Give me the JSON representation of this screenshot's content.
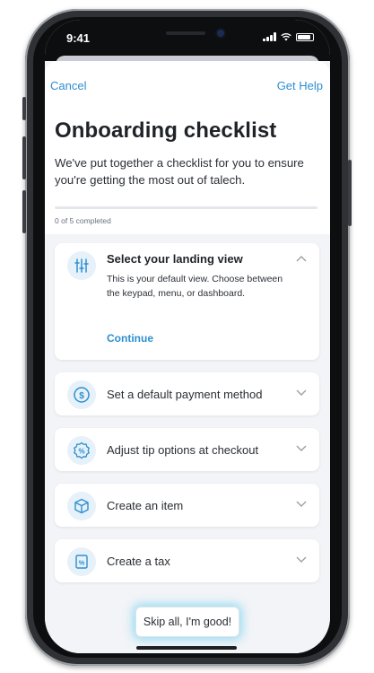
{
  "status_bar": {
    "time": "9:41"
  },
  "nav": {
    "cancel": "Cancel",
    "help": "Get Help"
  },
  "header": {
    "title": "Onboarding checklist",
    "subtitle": "We've put together a checklist for you to ensure you're getting the most out of talech."
  },
  "progress": {
    "text": "0 of 5 completed",
    "completed": 0,
    "total": 5
  },
  "checklist": [
    {
      "label": "Select your landing view",
      "icon": "sliders-icon",
      "expanded": true,
      "description": "This is your default view. Choose between the keypad, menu, or dashboard.",
      "action": "Continue"
    },
    {
      "label": "Set a default payment method",
      "icon": "dollar-coin-icon",
      "expanded": false
    },
    {
      "label": "Adjust tip options at checkout",
      "icon": "percent-badge-icon",
      "expanded": false
    },
    {
      "label": "Create an item",
      "icon": "box-icon",
      "expanded": false
    },
    {
      "label": "Create a tax",
      "icon": "tax-receipt-icon",
      "expanded": false
    }
  ],
  "footer": {
    "skip_label": "Skip all, I'm good!"
  },
  "colors": {
    "accent": "#2d8fd0",
    "background": "#f2f4f7",
    "glow": "#50c8f0"
  }
}
